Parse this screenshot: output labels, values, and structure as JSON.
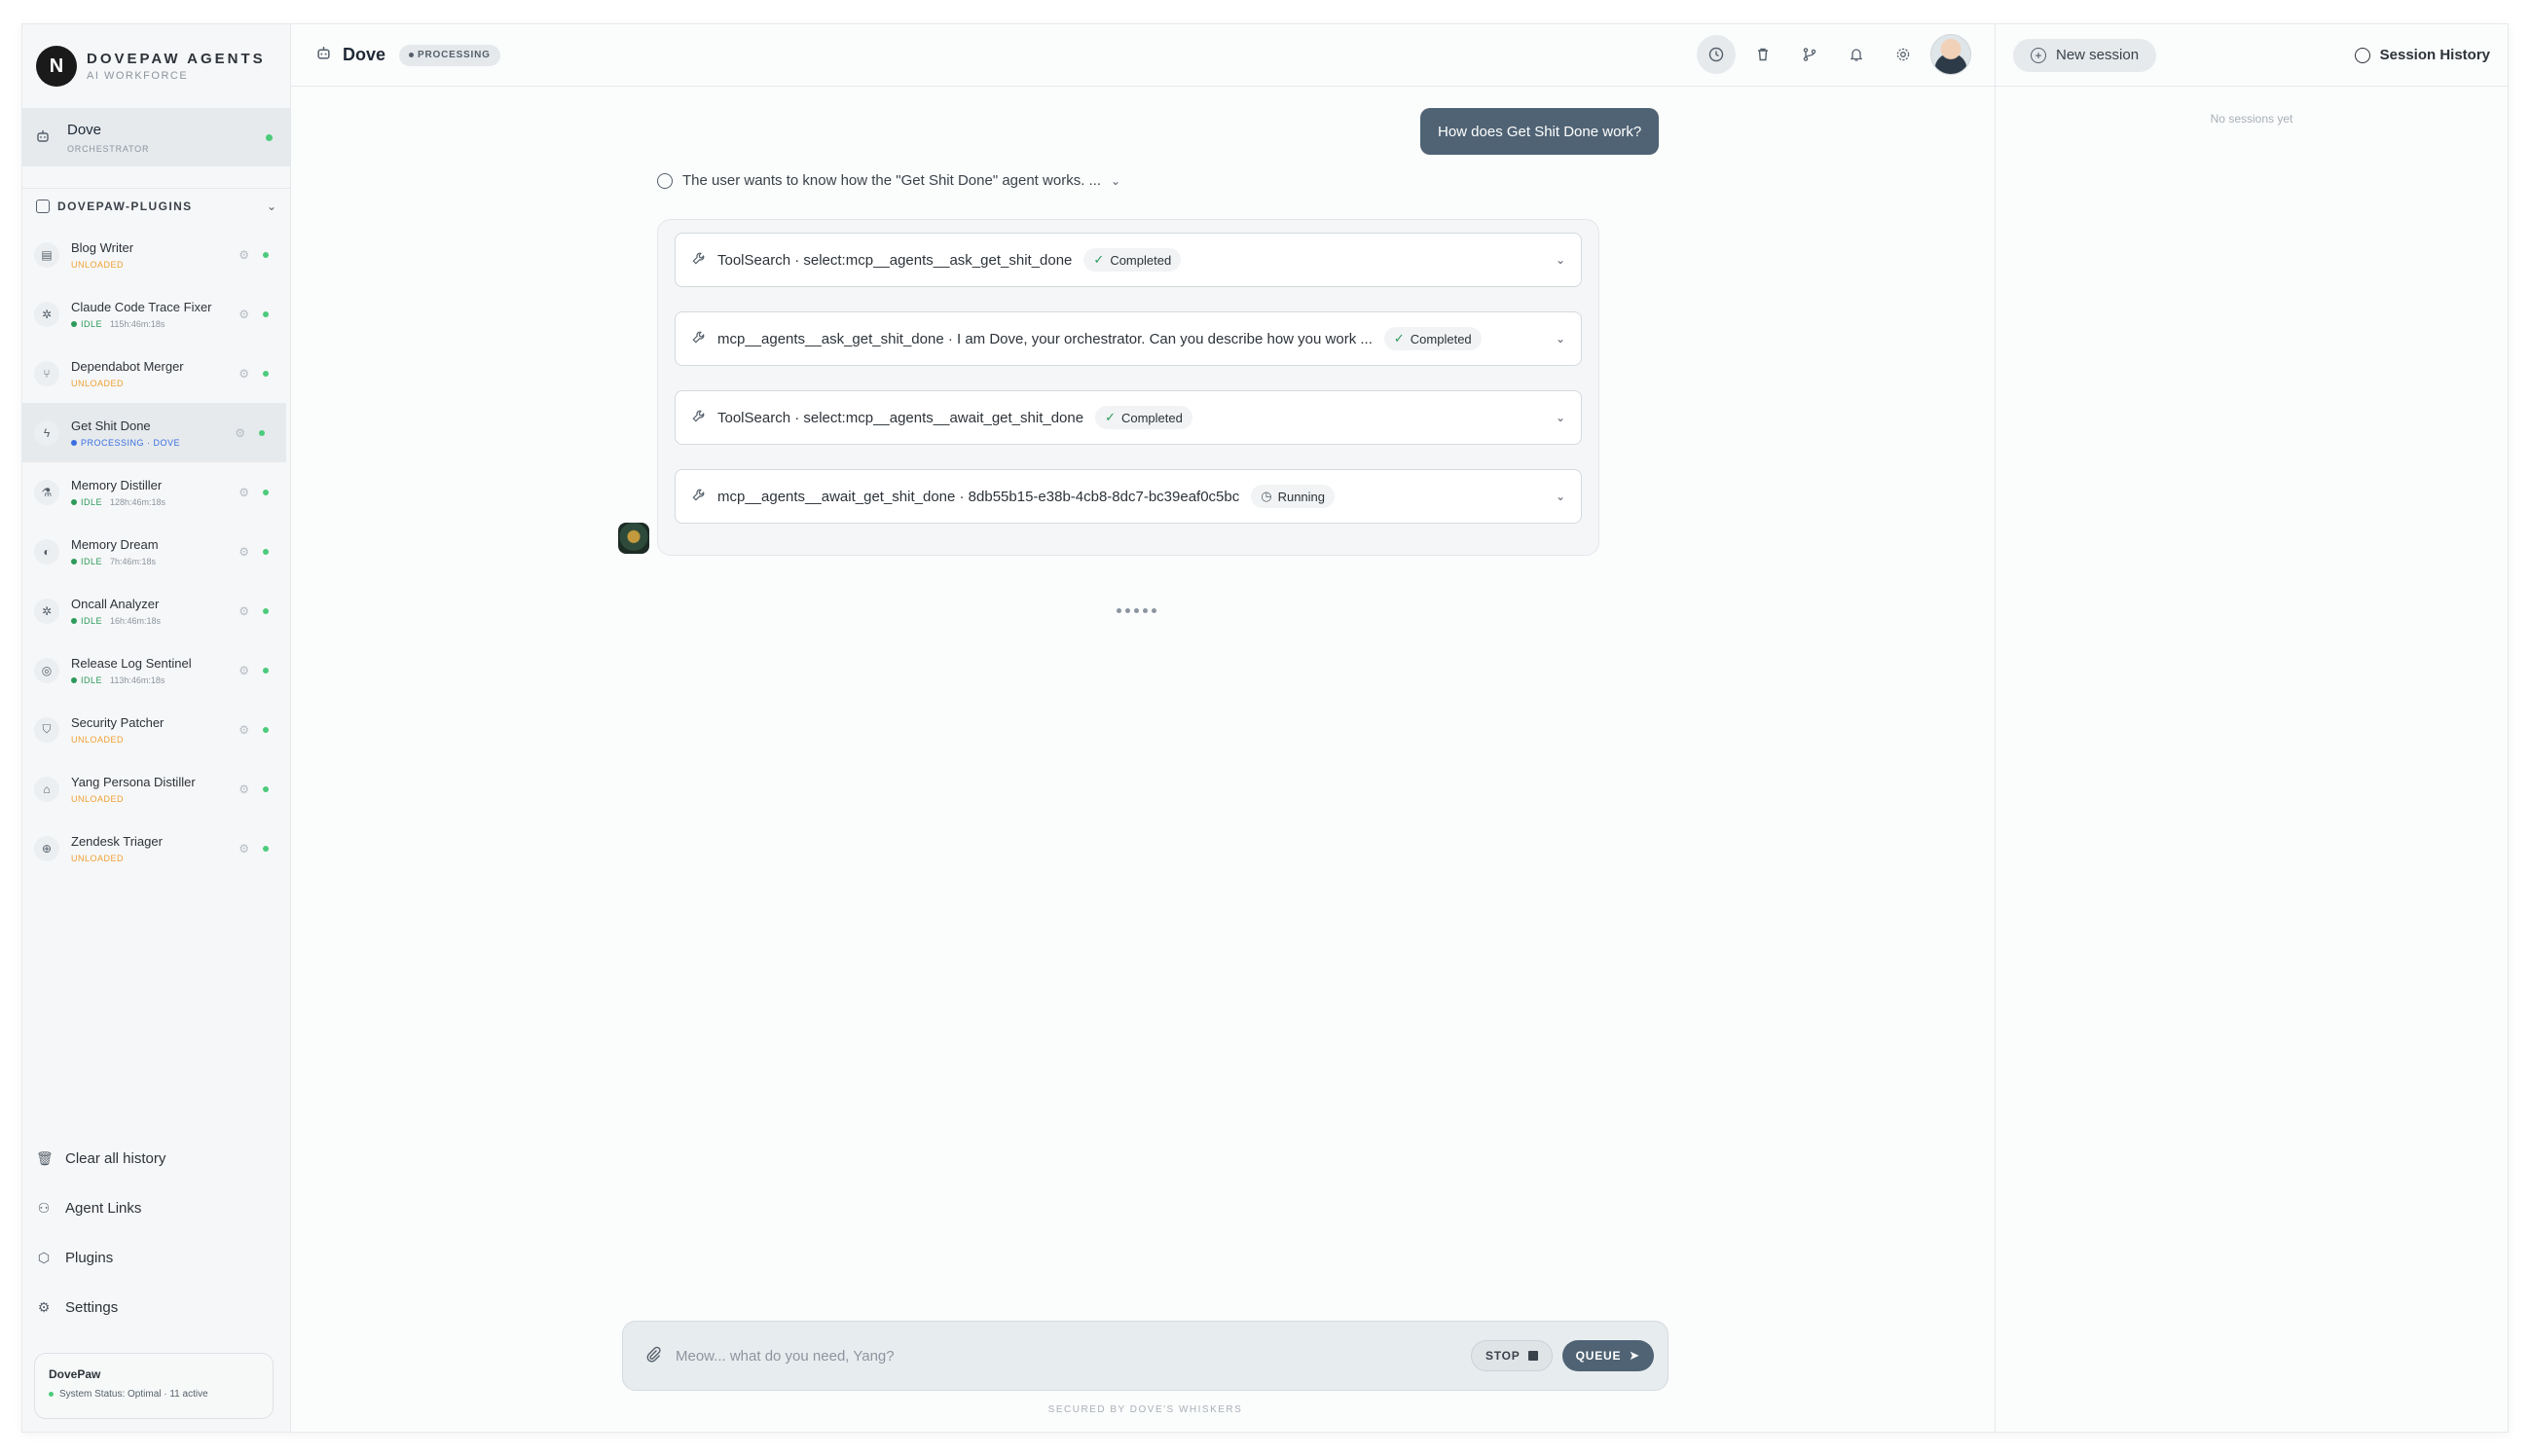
{
  "brand": {
    "logo_letter": "N",
    "title": "DOVEPAW AGENTS",
    "subtitle": "AI WORKFORCE"
  },
  "orchestrator": {
    "name": "Dove",
    "role": "ORCHESTRATOR",
    "icon": "robot-icon"
  },
  "plugin_group": {
    "label": "DOVEPAW-PLUGINS",
    "expanded": true
  },
  "plugins": [
    {
      "name": "Blog Writer",
      "status": "UNLOADED",
      "time": "",
      "icon": "document-icon"
    },
    {
      "name": "Claude Code Trace Fixer",
      "status": "IDLE",
      "time": "115h:46m:18s",
      "icon": "bug-icon"
    },
    {
      "name": "Dependabot Merger",
      "status": "UNLOADED",
      "time": "",
      "icon": "merge-icon"
    },
    {
      "name": "Get Shit Done",
      "status": "PROCESSING · DOVE",
      "time": "",
      "icon": "bolt-icon",
      "active": true
    },
    {
      "name": "Memory Distiller",
      "status": "IDLE",
      "time": "128h:46m:18s",
      "icon": "flask-icon"
    },
    {
      "name": "Memory Dream",
      "status": "IDLE",
      "time": "7h:46m:18s",
      "icon": "moon-icon"
    },
    {
      "name": "Oncall Analyzer",
      "status": "IDLE",
      "time": "16h:46m:18s",
      "icon": "bug-icon"
    },
    {
      "name": "Release Log Sentinel",
      "status": "IDLE",
      "time": "113h:46m:18s",
      "icon": "radar-icon"
    },
    {
      "name": "Security Patcher",
      "status": "UNLOADED",
      "time": "",
      "icon": "shield-icon"
    },
    {
      "name": "Yang Persona Distiller",
      "status": "UNLOADED",
      "time": "",
      "icon": "robot-icon"
    },
    {
      "name": "Zendesk Triager",
      "status": "UNLOADED",
      "time": "",
      "icon": "globe-icon"
    }
  ],
  "side_actions": [
    {
      "label": "Clear all history",
      "icon": "trash-icon"
    },
    {
      "label": "Agent Links",
      "icon": "network-icon"
    },
    {
      "label": "Plugins",
      "icon": "package-icon"
    },
    {
      "label": "Settings",
      "icon": "gear-icon"
    }
  ],
  "status_card": {
    "title": "DovePaw",
    "line": "System Status: Optimal · 11 active"
  },
  "topbar": {
    "title": "Dove",
    "badge": "PROCESSING",
    "tools": [
      "clock-icon",
      "trash-icon",
      "git-branch-icon",
      "bell-icon",
      "gear-icon"
    ]
  },
  "chat": {
    "user_message": "How does Get Shit Done work?",
    "thinking": "The user wants to know how the \"Get Shit Done\" agent works. ...",
    "tool_calls": [
      {
        "text": "ToolSearch · select:mcp__agents__ask_get_shit_done",
        "status": "Completed"
      },
      {
        "text": "mcp__agents__ask_get_shit_done · I am Dove, your orchestrator. Can you describe how you work ...",
        "status": "Completed"
      },
      {
        "text": "ToolSearch · select:mcp__agents__await_get_shit_done",
        "status": "Completed"
      },
      {
        "text": "mcp__agents__await_get_shit_done · 8db55b15-e38b-4cb8-8dc7-bc39eaf0c5bc",
        "status": "Running"
      }
    ]
  },
  "composer": {
    "placeholder": "Meow... what do you need, Yang?",
    "stop_label": "STOP",
    "queue_label": "QUEUE",
    "footer": "SECURED BY DOVE'S WHISKERS"
  },
  "history": {
    "new_session_label": "New session",
    "title": "Session History",
    "empty_text": "No sessions yet"
  },
  "colors": {
    "accent": "#4f6374",
    "idle": "#2c9a5a",
    "unloaded": "#f0a033",
    "processing": "#3b6fe0",
    "online": "#4ccb7c"
  }
}
